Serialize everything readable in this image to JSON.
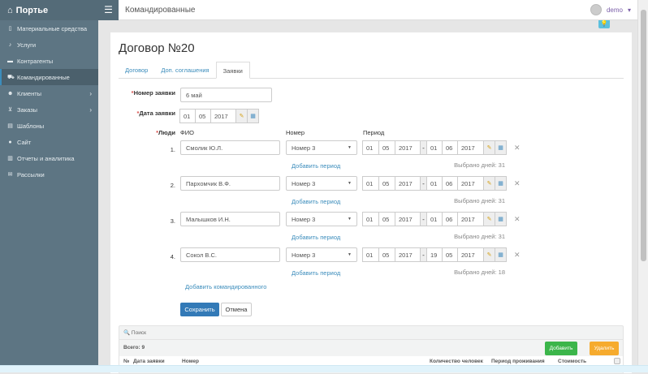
{
  "app": {
    "brand": "Портье",
    "page_title": "Командированные",
    "user": "demo"
  },
  "sidebar": {
    "items": [
      {
        "label": "Материальные средства",
        "icon": "tablet-icon"
      },
      {
        "label": "Услуги",
        "icon": "bell-icon"
      },
      {
        "label": "Контрагенты",
        "icon": "briefcase-icon"
      },
      {
        "label": "Командированные",
        "icon": "car-icon",
        "active": true
      },
      {
        "label": "Клиенты",
        "icon": "users-icon",
        "submenu": true
      },
      {
        "label": "Заказы",
        "icon": "cart-icon",
        "submenu": true
      },
      {
        "label": "Шаблоны",
        "icon": "file-icon"
      },
      {
        "label": "Сайт",
        "icon": "globe-icon"
      },
      {
        "label": "Отчеты и аналитика",
        "icon": "chart-icon"
      },
      {
        "label": "Рассылки",
        "icon": "envelope-icon"
      }
    ]
  },
  "form": {
    "title": "Договор №20",
    "tabs": [
      "Договор",
      "Доп. соглашения",
      "Заявки"
    ],
    "number_label": "Номер заявки",
    "number_value": "6 май",
    "date_label": "Дата заявки",
    "date": {
      "d": "01",
      "m": "05",
      "y": "2017"
    },
    "people_label": "Люди",
    "col_fio": "ФИО",
    "col_room": "Номер",
    "col_period": "Период",
    "add_period": "Добавить период",
    "people": [
      {
        "n": "1.",
        "fio": "Смолик Ю.Л.",
        "room": "Номер 3",
        "from": {
          "d": "01",
          "m": "05",
          "y": "2017"
        },
        "to": {
          "d": "01",
          "m": "06",
          "y": "2017"
        },
        "days": "Выбрано дней: 31"
      },
      {
        "n": "2.",
        "fio": "Пархомчик В.Ф.",
        "room": "Номер 3",
        "from": {
          "d": "01",
          "m": "05",
          "y": "2017"
        },
        "to": {
          "d": "01",
          "m": "06",
          "y": "2017"
        },
        "days": "Выбрано дней: 31"
      },
      {
        "n": "3.",
        "fio": "Малышков И.Н.",
        "room": "Номер 3",
        "from": {
          "d": "01",
          "m": "05",
          "y": "2017"
        },
        "to": {
          "d": "01",
          "m": "06",
          "y": "2017"
        },
        "days": "Выбрано дней: 31"
      },
      {
        "n": "4.",
        "fio": "Сокол В.С.",
        "room": "Номер 3",
        "from": {
          "d": "01",
          "m": "05",
          "y": "2017"
        },
        "to": {
          "d": "19",
          "m": "05",
          "y": "2017"
        },
        "days": "Выбрано дней: 18"
      }
    ],
    "add_person": "Добавить командированного",
    "save": "Сохранить",
    "cancel": "Отмена"
  },
  "table": {
    "search": "Поиск",
    "total": "Всего: 9",
    "add": "Добавить",
    "delete": "Удалить",
    "columns": [
      "№",
      "Дата заявки",
      "Номер",
      "Количество человек",
      "Период проживания",
      "Стоимость"
    ]
  },
  "colors": {
    "sidebar": "#5d7583",
    "link": "#3c8dbc",
    "primary": "#337ab7",
    "success": "#3bb54a",
    "warning": "#f6ab2e"
  }
}
